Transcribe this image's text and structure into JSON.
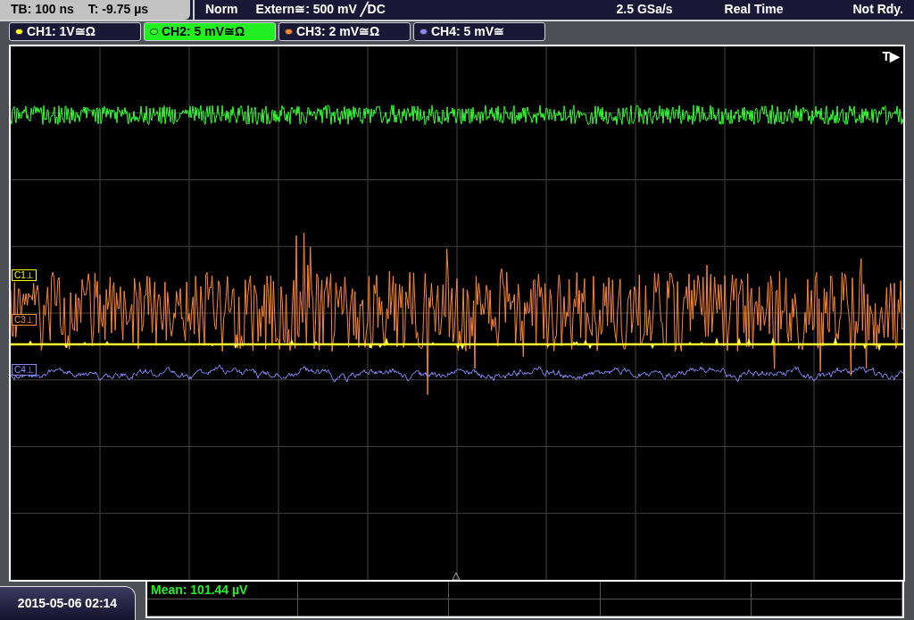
{
  "status_bar": {
    "timebase": "TB: 100 ns",
    "trigger_time": "T: -9.75 µs",
    "mode": "Norm",
    "trigger_source": "Extern≅: 500 mV ╱DC",
    "sample_rate": "2.5 GSa/s",
    "acquisition": "Real Time",
    "state": "Not Rdy."
  },
  "channels": [
    {
      "label": "CH1: 1V≅Ω",
      "color": "#ffff33",
      "selected": false
    },
    {
      "label": "CH2: 5 mV≅Ω",
      "color": "#33ff33",
      "selected": true
    },
    {
      "label": "CH3: 2 mV≅Ω",
      "color": "#ff8833",
      "selected": false
    },
    {
      "label": "CH4: 5 mV≅",
      "color": "#8888ff",
      "selected": false
    }
  ],
  "plot": {
    "trigger_marker": "T▶",
    "markers": [
      {
        "label": "C1⊥",
        "color": "#ffff00"
      },
      {
        "label": "C3⊥",
        "color": "#ff8833"
      },
      {
        "label": "C4⊥",
        "color": "#8888ff"
      }
    ]
  },
  "date": "2015-05-06 02:14",
  "measurements": [
    {
      "text": "Mean: 101.44 µV",
      "color": "#22ee22"
    }
  ]
}
